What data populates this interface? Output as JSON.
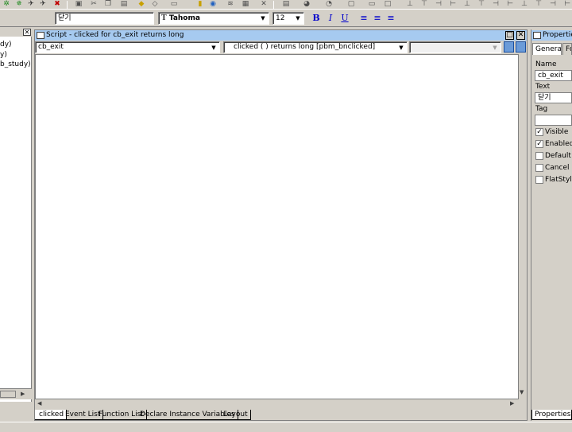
{
  "toolbar": {
    "text_value": "닫기",
    "font_value": "Tahoma",
    "font_size_value": "12",
    "font_icon_glyph": "T",
    "bold_label": "B",
    "italic_label": "I",
    "underline_label": "U"
  },
  "left_panel": {
    "items": [
      "dy)",
      "y)",
      "b_study)"
    ]
  },
  "script": {
    "title": "Script - clicked for cb_exit returns long",
    "object_select": "cb_exit",
    "event_select": "clicked ( )  returns long [pbm_bnclicked]",
    "third_select": "",
    "tabs": [
      "clicked",
      "Event List",
      "Function List",
      "Declare Instance Variables",
      "Layout"
    ]
  },
  "properties": {
    "title": "Properties",
    "tabs": [
      "General",
      "Fo"
    ],
    "name_label": "Name",
    "name_value": "cb_exit",
    "text_label": "Text",
    "text_value": "닫기",
    "tag_label": "Tag",
    "tag_value": "",
    "checkboxes": [
      {
        "label": "Visible",
        "checked": true
      },
      {
        "label": "Enabled",
        "checked": true
      },
      {
        "label": "Default",
        "checked": false
      },
      {
        "label": "Cancel",
        "checked": false
      },
      {
        "label": "FlatStyle",
        "checked": false
      }
    ],
    "bottom_tab": "Properties"
  },
  "colors": {
    "titlebar": "#a6caf0",
    "chrome": "#d4d0c8",
    "accent_blue": "#0000cc"
  }
}
